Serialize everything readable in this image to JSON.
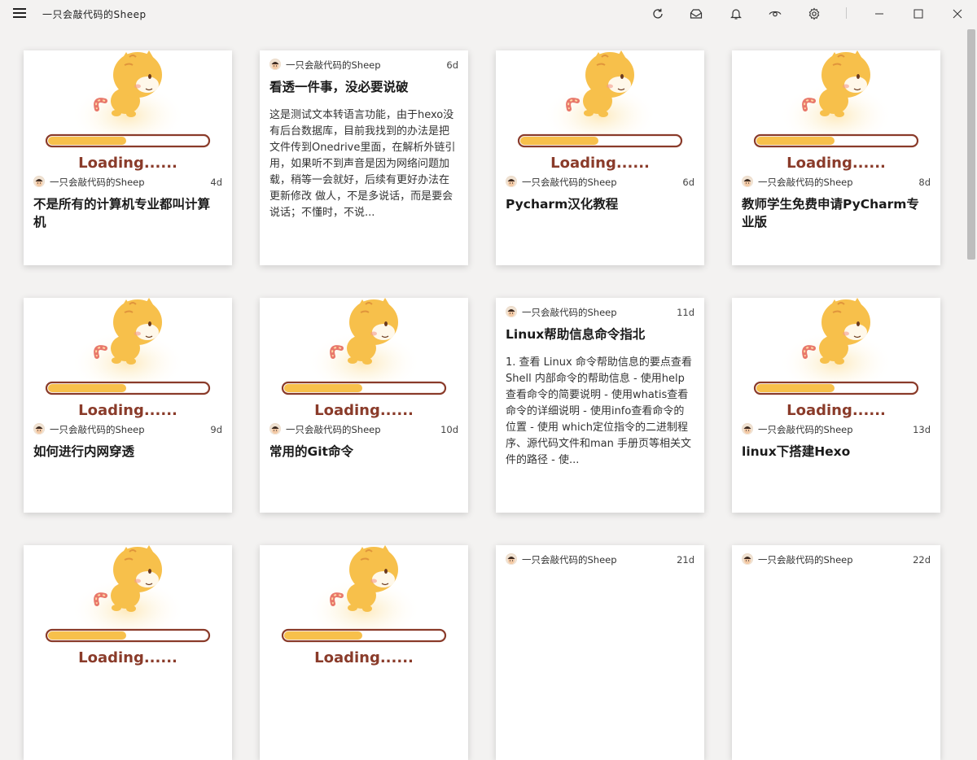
{
  "app": {
    "title": "一只会敲代码的Sheep"
  },
  "toolbar": {
    "icons": [
      "refresh-icon",
      "inbox-icon",
      "bell-icon",
      "eye-icon",
      "gear-icon"
    ],
    "window": [
      "minimize-icon",
      "maximize-icon",
      "close-icon"
    ]
  },
  "loading_text": "Loading......",
  "cards": [
    {
      "author": "一只会敲代码的Sheep",
      "age": "4d",
      "title": "不是所有的计算机专业都叫计算机",
      "summary": "",
      "has_image": true
    },
    {
      "author": "一只会敲代码的Sheep",
      "age": "6d",
      "title": "看透一件事，没必要说破",
      "summary": "这是测试文本转语言功能，由于hexo没有后台数据库，目前我找到的办法是把文件传到Onedrive里面，在解析外链引用，如果听不到声音是因为网络问题加载，稍等一会就好，后续有更好办法在更新修改 做人，不是多说话，而是要会说话；不懂时，不说...",
      "has_image": false
    },
    {
      "author": "一只会敲代码的Sheep",
      "age": "6d",
      "title": "Pycharm汉化教程",
      "summary": "",
      "has_image": true
    },
    {
      "author": "一只会敲代码的Sheep",
      "age": "8d",
      "title": "教师学生免费申请PyCharm专业版",
      "summary": "",
      "has_image": true
    },
    {
      "author": "一只会敲代码的Sheep",
      "age": "9d",
      "title": "如何进行内网穿透",
      "summary": "",
      "has_image": true
    },
    {
      "author": "一只会敲代码的Sheep",
      "age": "10d",
      "title": "常用的Git命令",
      "summary": "",
      "has_image": true
    },
    {
      "author": "一只会敲代码的Sheep",
      "age": "11d",
      "title": "Linux帮助信息命令指北",
      "summary": "1. 查看 Linux 命令帮助信息的要点查看 Shell 内部命令的帮助信息 - 使用help查看命令的简要说明 - 使用whatis查看命令的详细说明 - 使用info查看命令的位置 - 使用 which定位指令的二进制程序、源代码文件和man 手册页等相关文件的路径 - 使...",
      "has_image": false
    },
    {
      "author": "一只会敲代码的Sheep",
      "age": "13d",
      "title": "linux下搭建Hexo",
      "summary": "",
      "has_image": true
    },
    {
      "author": "",
      "age": "",
      "title": "",
      "summary": "",
      "has_image": true
    },
    {
      "author": "",
      "age": "",
      "title": "",
      "summary": "",
      "has_image": true
    },
    {
      "author": "一只会敲代码的Sheep",
      "age": "21d",
      "title": "",
      "summary": "",
      "has_image": false
    },
    {
      "author": "一只会敲代码的Sheep",
      "age": "22d",
      "title": "",
      "summary": "",
      "has_image": false
    }
  ]
}
